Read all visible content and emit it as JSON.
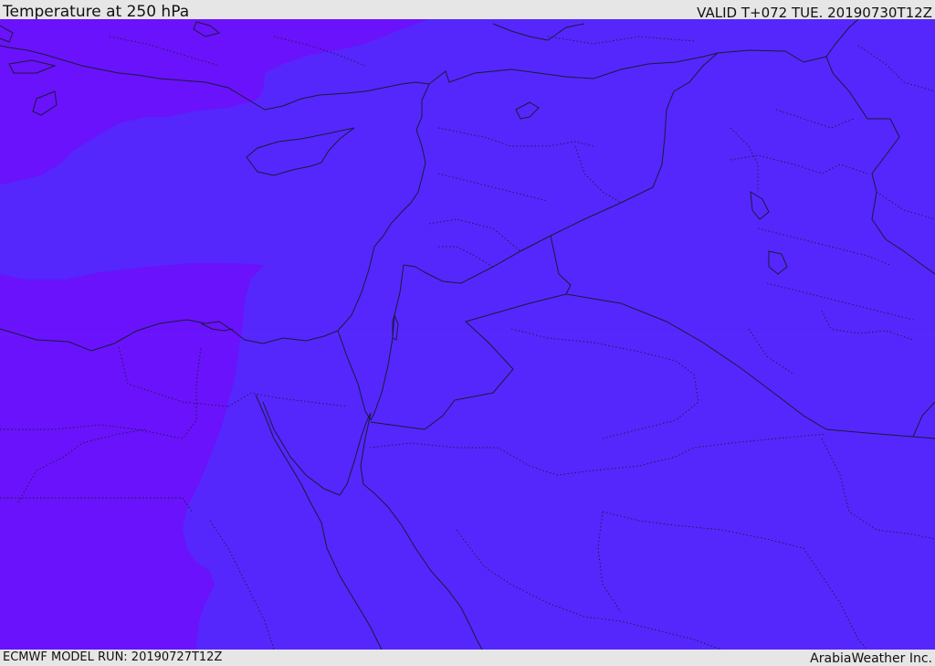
{
  "header": {
    "title": "Temperature at 250 hPa",
    "valid_time": "VALID T+072 TUE. 20190730T12Z"
  },
  "footer": {
    "model_run": "ECMWF MODEL RUN: 20190727T12Z",
    "credit": "ArabiaWeather Inc."
  },
  "colors": {
    "field_warm": "#6a12fb",
    "field_cool": "#5527fd",
    "border_line": "#1a1a3a",
    "bar_background": "#e6e6e6"
  }
}
